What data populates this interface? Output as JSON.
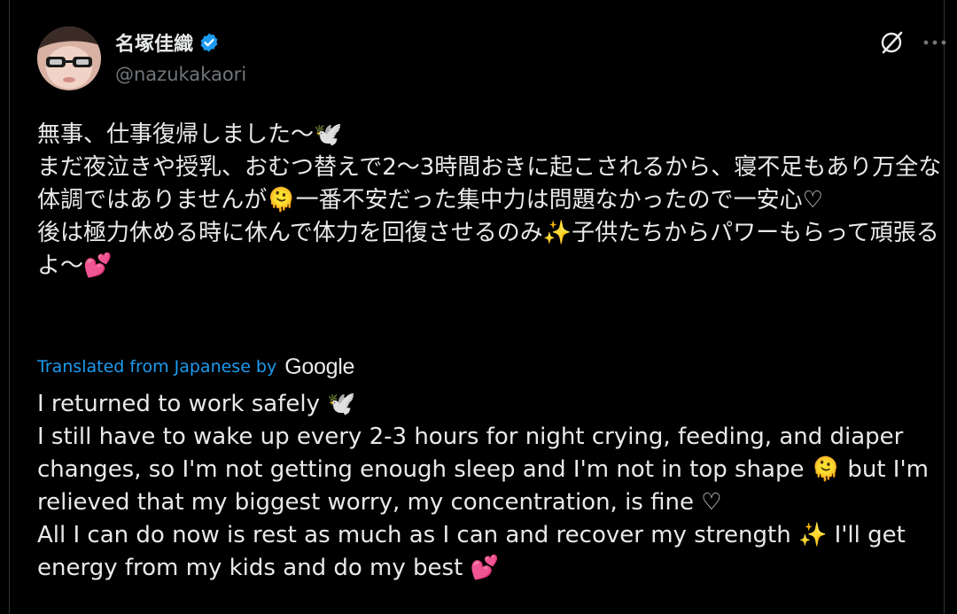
{
  "author": {
    "display_name": "名塚佳織",
    "handle": "@nazukakaori",
    "verified": true,
    "avatar": "avatar-photo"
  },
  "actions": {
    "grok_icon": "grok-slash-circle-icon",
    "more_icon": "more-horizontal-icon"
  },
  "post": {
    "original_text": "無事、仕事復帰しました〜🕊️\nまだ夜泣きや授乳、おむつ替えで2〜3時間おきに起こされるから、寝不足もあり万全な体調ではありませんが🫠一番不安だった集中力は問題なかったので一安心♡\n後は極力休める時に休んで体力を回復させるのみ✨子供たちからパワーもらって頑張るよ〜💕",
    "translated_label": "Translated from Japanese by",
    "translator": "Google",
    "translated_text": "I returned to work safely 🕊️\nI still have to wake up every 2-3 hours for night crying, feeding, and diaper changes, so I'm not getting enough sleep and I'm not in top shape 🫠 but I'm relieved that my biggest worry, my concentration, is fine ♡\nAll I can do now is rest as much as I can and recover my strength ✨ I'll get energy from my kids and do my best 💕"
  },
  "colors": {
    "background": "#000000",
    "text": "#e7e9ea",
    "secondary": "#71767b",
    "link": "#1d9bf0",
    "verified_badge": "#1d9bf0"
  }
}
